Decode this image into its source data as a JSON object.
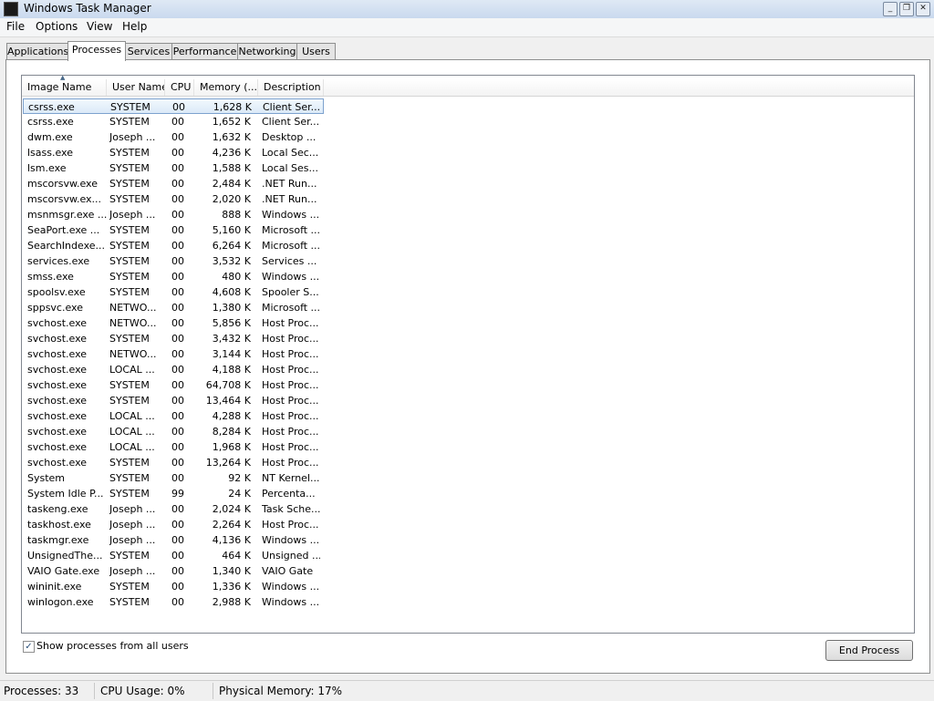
{
  "window": {
    "title": "Windows Task Manager"
  },
  "menu": [
    "File",
    "Options",
    "View",
    "Help"
  ],
  "tabs": [
    "Applications",
    "Processes",
    "Services",
    "Performance",
    "Networking",
    "Users"
  ],
  "columns": [
    "Image Name",
    "User Name",
    "CPU",
    "Memory (...",
    "Description"
  ],
  "processes": [
    [
      "csrss.exe",
      "SYSTEM",
      "00",
      "1,628 K",
      "Client Ser..."
    ],
    [
      "csrss.exe",
      "SYSTEM",
      "00",
      "1,652 K",
      "Client Ser..."
    ],
    [
      "dwm.exe",
      "Joseph ...",
      "00",
      "1,632 K",
      "Desktop ..."
    ],
    [
      "lsass.exe",
      "SYSTEM",
      "00",
      "4,236 K",
      "Local Sec..."
    ],
    [
      "lsm.exe",
      "SYSTEM",
      "00",
      "1,588 K",
      "Local Ses..."
    ],
    [
      "mscorsvw.exe",
      "SYSTEM",
      "00",
      "2,484 K",
      ".NET Run..."
    ],
    [
      "mscorsvw.ex...",
      "SYSTEM",
      "00",
      "2,020 K",
      ".NET Run..."
    ],
    [
      "msnmsgr.exe ...",
      "Joseph ...",
      "00",
      "888 K",
      "Windows ..."
    ],
    [
      "SeaPort.exe ...",
      "SYSTEM",
      "00",
      "5,160 K",
      "Microsoft ..."
    ],
    [
      "SearchIndexe...",
      "SYSTEM",
      "00",
      "6,264 K",
      "Microsoft ..."
    ],
    [
      "services.exe",
      "SYSTEM",
      "00",
      "3,532 K",
      "Services ..."
    ],
    [
      "smss.exe",
      "SYSTEM",
      "00",
      "480 K",
      "Windows ..."
    ],
    [
      "spoolsv.exe",
      "SYSTEM",
      "00",
      "4,608 K",
      "Spooler S..."
    ],
    [
      "sppsvc.exe",
      "NETWO...",
      "00",
      "1,380 K",
      "Microsoft ..."
    ],
    [
      "svchost.exe",
      "NETWO...",
      "00",
      "5,856 K",
      "Host Proc..."
    ],
    [
      "svchost.exe",
      "SYSTEM",
      "00",
      "3,432 K",
      "Host Proc..."
    ],
    [
      "svchost.exe",
      "NETWO...",
      "00",
      "3,144 K",
      "Host Proc..."
    ],
    [
      "svchost.exe",
      "LOCAL ...",
      "00",
      "4,188 K",
      "Host Proc..."
    ],
    [
      "svchost.exe",
      "SYSTEM",
      "00",
      "64,708 K",
      "Host Proc..."
    ],
    [
      "svchost.exe",
      "SYSTEM",
      "00",
      "13,464 K",
      "Host Proc..."
    ],
    [
      "svchost.exe",
      "LOCAL ...",
      "00",
      "4,288 K",
      "Host Proc..."
    ],
    [
      "svchost.exe",
      "LOCAL ...",
      "00",
      "8,284 K",
      "Host Proc..."
    ],
    [
      "svchost.exe",
      "LOCAL ...",
      "00",
      "1,968 K",
      "Host Proc..."
    ],
    [
      "svchost.exe",
      "SYSTEM",
      "00",
      "13,264 K",
      "Host Proc..."
    ],
    [
      "System",
      "SYSTEM",
      "00",
      "92 K",
      "NT Kernel..."
    ],
    [
      "System Idle P...",
      "SYSTEM",
      "99",
      "24 K",
      "Percenta..."
    ],
    [
      "taskeng.exe",
      "Joseph ...",
      "00",
      "2,024 K",
      "Task Sche..."
    ],
    [
      "taskhost.exe",
      "Joseph ...",
      "00",
      "2,264 K",
      "Host Proc..."
    ],
    [
      "taskmgr.exe",
      "Joseph ...",
      "00",
      "4,136 K",
      "Windows ..."
    ],
    [
      "UnsignedThe...",
      "SYSTEM",
      "00",
      "464 K",
      "Unsigned ..."
    ],
    [
      "VAIO Gate.exe",
      "Joseph ...",
      "00",
      "1,340 K",
      "VAIO Gate"
    ],
    [
      "wininit.exe",
      "SYSTEM",
      "00",
      "1,336 K",
      "Windows ..."
    ],
    [
      "winlogon.exe",
      "SYSTEM",
      "00",
      "2,988 K",
      "Windows ..."
    ]
  ],
  "show_all_users": {
    "label": "Show processes from all users",
    "checked": true
  },
  "end_process_label": "End Process",
  "status": {
    "processes": "Processes: 33",
    "cpu": "CPU Usage: 0%",
    "memory": "Physical Memory: 17%"
  },
  "icons": [
    "app-icon",
    "minimize-icon",
    "restore-icon",
    "close-icon",
    "sort-ascending-icon",
    "checkmark-icon"
  ]
}
